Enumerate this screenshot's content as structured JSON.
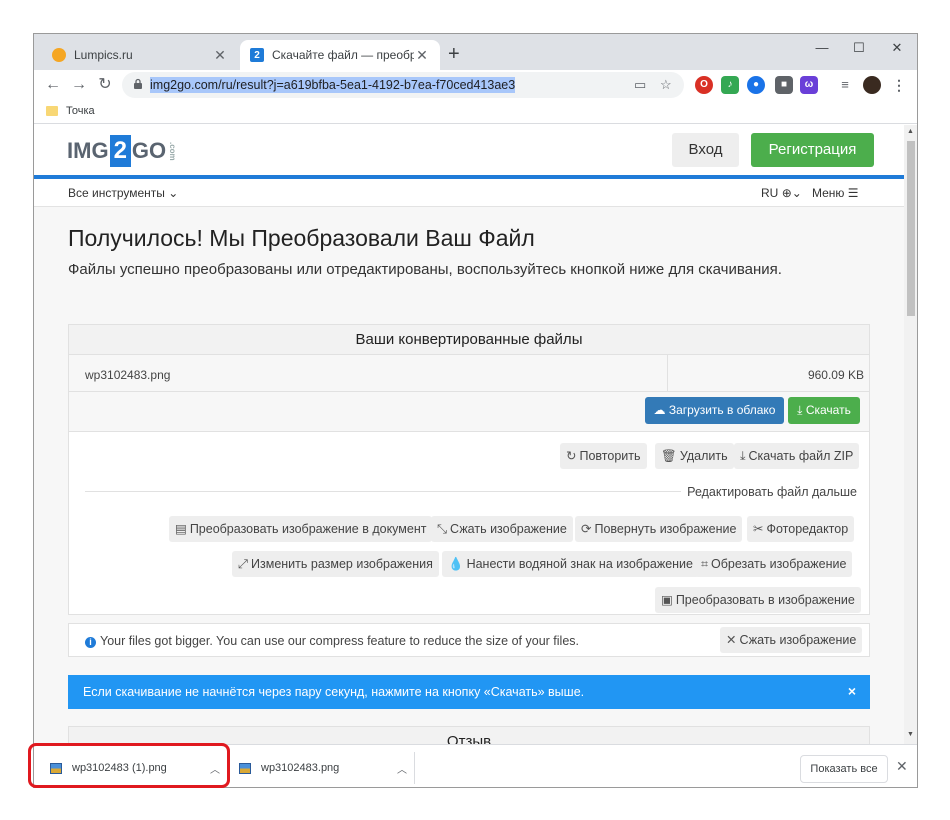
{
  "browser": {
    "tabs": [
      {
        "title": "Lumpics.ru",
        "close": "✕"
      },
      {
        "title": "Скачайте файл — преобразова",
        "favicon_text": "2",
        "close": "✕"
      }
    ],
    "new_tab": "+",
    "window_controls": {
      "minimize": "—",
      "maximize": "☐",
      "close": "✕"
    },
    "url": "img2go.com/ru/result?j=a619bfba-5ea1-4192-b7ea-f70ced413ae3",
    "bookmark": "Точка"
  },
  "site": {
    "logo": {
      "part1": "IMG",
      "part2": "2",
      "part3": "GO",
      "suffix": ".com"
    },
    "login": "Вход",
    "register": "Регистрация",
    "all_tools": "Все инструменты",
    "lang": "RU",
    "menu": "Меню",
    "headline": "Получилось! Мы Преобразовали Ваш Файл",
    "intro": "Файлы успешно преобразованы или отредактированы, воспользуйтесь кнопкой ниже для скачивания."
  },
  "panel": {
    "title": "Ваши конвертированные файлы",
    "file_name": "wp3102483.png",
    "file_size": "960.09 KB",
    "upload_cloud": "Загрузить в облако",
    "download": "Скачать",
    "retry": "Повторить",
    "delete": "Удалить",
    "download_zip": "Скачать файл ZIP",
    "edit_further": "Редактировать файл дальше",
    "tools": [
      "Преобразовать изображение в документ",
      "Сжать изображение",
      "Повернуть изображение",
      "Фоторедактор",
      "Изменить размер изображения",
      "Нанести водяной знак на изображение",
      "Обрезать изображение",
      "Преобразовать в изображение"
    ]
  },
  "info": {
    "text": "Your files got bigger. You can use our compress feature to reduce the size of your files.",
    "button": "Сжать изображение"
  },
  "alert": {
    "text": "Если скачивание не начнётся через пару секунд, нажмите на кнопку «Скачать» выше.",
    "close": "×"
  },
  "review": {
    "title": "Отзыв"
  },
  "downloads": {
    "items": [
      {
        "name": "wp3102483 (1).png"
      },
      {
        "name": "wp3102483.png"
      }
    ],
    "show_all": "Показать все",
    "close": "✕"
  },
  "colors": {
    "accent_blue": "#1f7bd8",
    "green": "#4cae4c",
    "cloud_blue": "#337ab7",
    "alert_blue": "#2196f3",
    "highlight_red": "#e0191f"
  }
}
